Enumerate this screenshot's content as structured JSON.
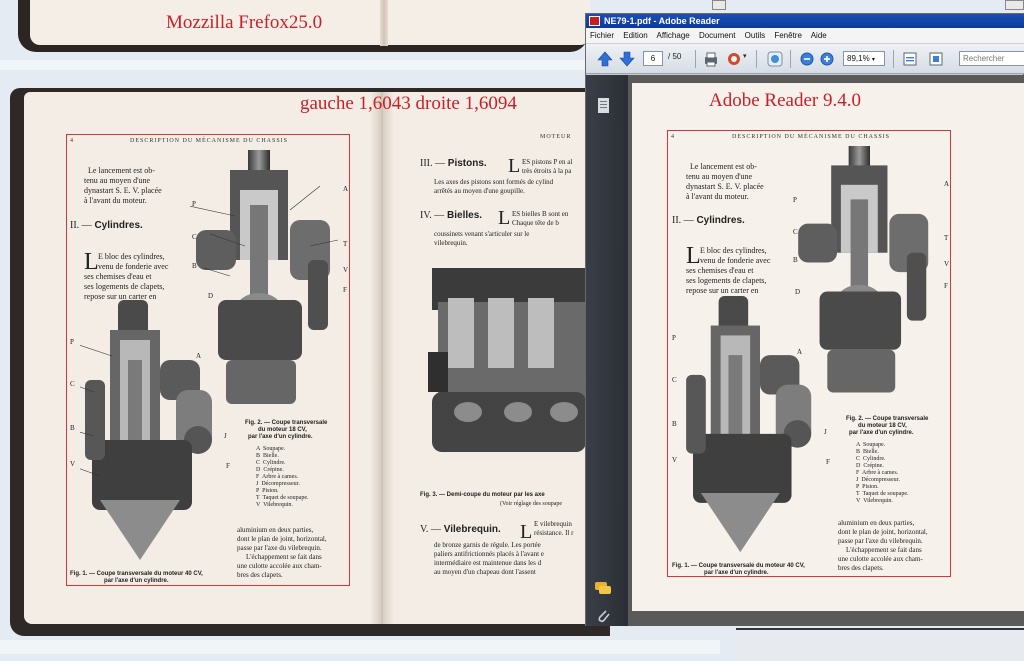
{
  "comparison": {
    "firefox_label": "Mozzilla Frefox25.0",
    "ratio_text": "gauche  1,6043  droite 1,6094",
    "reader_label": "Adobe Reader 9.4.0"
  },
  "adobe": {
    "title": "NE79-1.pdf - Adobe Reader",
    "menu": [
      "Fichier",
      "Edition",
      "Affichage",
      "Document",
      "Outils",
      "Fenêtre",
      "Aide"
    ],
    "page_current": "6",
    "page_total": "/ 50",
    "zoom": "89,1%",
    "search_placeholder": "Rechercher"
  },
  "left_page": {
    "header": "DESCRIPTION DU MÉCANISME DU CHASSIS",
    "page_number": "4",
    "intro": [
      "Le lancement est ob-",
      "tenu au moyen d'une",
      "dynastart S. E. V. placée",
      "à l'avant du moteur."
    ],
    "section_num": "II. —",
    "section_title": "Cylindres.",
    "body": [
      "E bloc des cylindres,",
      "venu de fonderie avec",
      "ses chemises d'eau et",
      "ses logements de clapets,",
      "repose sur un carter en"
    ],
    "drop_cap": "L",
    "fig1_caption": [
      "Fig. 1. — Coupe transversale du moteur 40 CV,",
      "par l'axe d'un cylindre."
    ],
    "fig2_caption": [
      "Fig. 2. — Coupe transversale",
      "du moteur 18 CV,",
      "par l'axe d'un cylindre."
    ],
    "legend": [
      "A  Soupape.",
      "B  Bielle.",
      "C  Cylindre.",
      "D  Crépine.",
      "F  Arbre à cames.",
      "J  Décompresseur.",
      "P  Piston.",
      "T  Taquet de soupape.",
      "V  Vilebrequin."
    ],
    "lower_text": [
      "aluminium en deux parties,",
      "dont le plan de joint, horizontal,",
      "passe par l'axe du vilebrequin.",
      "L'échappement se fait dans",
      "une culotte accolée aux cham-",
      "bres des clapets."
    ]
  },
  "right_page": {
    "header": "MOTEUR",
    "s3_num": "III. —",
    "s3_title": "Pistons.",
    "s3_text": [
      "ES pistons P en al",
      "très étroits à la pa"
    ],
    "s3_body": [
      "Les axes des pistons sont formés de cylind",
      "arrêtés au moyen d'une goupille."
    ],
    "s4_num": "IV. —",
    "s4_title": "Bielles.",
    "s4_text": [
      "ES bielles B sont en",
      "Chaque tête de b"
    ],
    "s4_body": [
      "coussinets venant s'articuler sur le",
      "vilebrequin."
    ],
    "fig3_caption": "Fig. 3. — Demi-coupe du moteur par les axe",
    "fig3_sub": "(Voir réglage des soupape",
    "s5_num": "V. —",
    "s5_title": "Vilebrequin.",
    "s5_text": [
      "E vilebrequin",
      "résistance. Il r"
    ],
    "s5_body": [
      "de bronze garnis de régule. Les portée",
      "paliers antifrictionnés placés à l'avant e",
      "intermédiaire est maintenue dans les d",
      "au moyen d'un chapeau dont l'assent"
    ]
  },
  "labels": {
    "A": "A",
    "B": "B",
    "C": "C",
    "D": "D",
    "F": "F",
    "J": "J",
    "P": "P",
    "T": "T",
    "V": "V"
  }
}
